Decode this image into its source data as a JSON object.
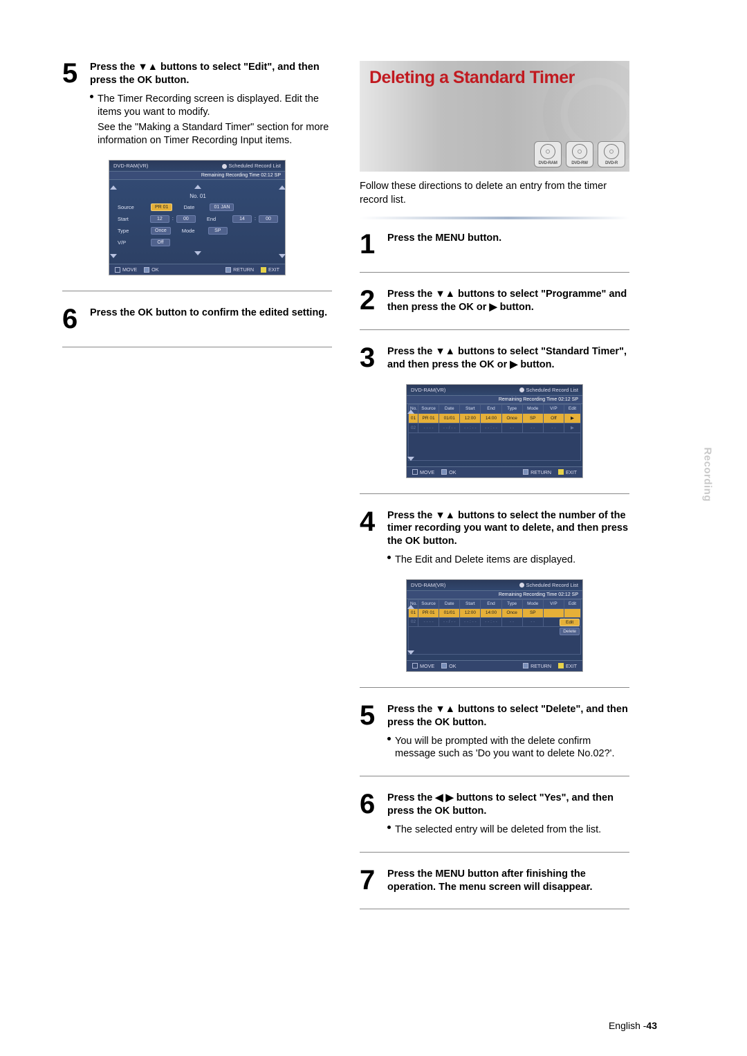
{
  "left": {
    "step5": {
      "title_pre": "Press the ",
      "title_mid": " buttons to select \"Edit\", and then press the OK button.",
      "bullet1": "The Timer Recording screen is displayed. Edit the items you want to modify.",
      "desc2": "See the \"Making a Standard Timer\" section for more information on Timer Recording Input items."
    },
    "step6": {
      "title": "Press the OK button to confirm the edited setting."
    },
    "osd1": {
      "disc": "DVD-RAM(VR)",
      "header": "Scheduled Record List",
      "remaining": "Remaining Recording Time 02:12 SP",
      "form_title": "No. 01",
      "rows": {
        "source": {
          "label": "Source",
          "val": "PR 01",
          "date_label": "Date",
          "date_val": "01 JAN"
        },
        "start": {
          "label": "Start",
          "h": "12",
          "m": "00",
          "end_label": "End",
          "eh": "14",
          "em": "00"
        },
        "type": {
          "label": "Type",
          "val": "Once",
          "mode_label": "Mode",
          "mode_val": "SP"
        },
        "vp": {
          "label": "V/P",
          "val": "Off"
        }
      },
      "foot": {
        "move": "MOVE",
        "ok": "OK",
        "ret": "RETURN",
        "exit": "EXIT"
      }
    }
  },
  "right": {
    "title": "Deleting a Standard Timer",
    "discs": [
      "DVD-RAM",
      "DVD-RW",
      "DVD-R"
    ],
    "intro": "Follow these directions to delete an entry from the timer record list.",
    "step1": {
      "title": "Press the MENU button."
    },
    "step2": {
      "title_pre": "Press the ",
      "title_mid": " buttons to select \"Programme\" and then press the OK or ",
      "title_post": " button."
    },
    "step3": {
      "title_pre": "Press the ",
      "title_mid": " buttons to select \"Standard Timer\", and then press the OK or ",
      "title_post": " button."
    },
    "step4": {
      "title_pre": "Press the ",
      "title_mid": " buttons to select the number of the timer recording you want to delete, and then press the OK button.",
      "bullet": "The Edit and Delete items are displayed."
    },
    "step5": {
      "title_pre": "Press the ",
      "title_mid": " buttons to select \"Delete\", and then press the OK button.",
      "bullet": "You will be prompted with the delete confirm message such as 'Do you want to delete No.02?'."
    },
    "step6": {
      "title_pre": "Press the ",
      "title_mid": " buttons to select \"Yes\", and then press the OK button.",
      "bullet": "The selected entry will be deleted from the list."
    },
    "step7": {
      "title": "Press the MENU button after finishing the operation. The menu screen will disappear."
    },
    "osd_table": {
      "disc": "DVD-RAM(VR)",
      "header": "Scheduled Record List",
      "remaining": "Remaining Recording Time 02:12 SP",
      "cols": [
        "No.",
        "Source",
        "Date",
        "Start",
        "End",
        "Type",
        "Mode",
        "V/P",
        "Edit"
      ],
      "rows": [
        {
          "no": "01",
          "source": "PR 01",
          "date": "01/01",
          "start": "12:00",
          "end": "14:00",
          "type": "Once",
          "mode": "SP",
          "vp": "Off",
          "edit": "▶",
          "sel": true
        },
        {
          "no": "02",
          "source": "- - - -",
          "date": "- - / - -",
          "start": "- - : - -",
          "end": "- - : - -",
          "type": "- -",
          "mode": "- -",
          "vp": "- -",
          "edit": "▶",
          "sel": false
        }
      ],
      "foot": {
        "move": "MOVE",
        "ok": "OK",
        "ret": "RETURN",
        "exit": "EXIT"
      }
    },
    "osd_table2": {
      "popup": {
        "edit": "Edit",
        "delete": "Delete"
      }
    }
  },
  "side_tab": "Recording",
  "footer": {
    "lang": "English -",
    "page": "43"
  },
  "icons": {
    "updown": "▼▲",
    "right": "▶",
    "leftright": "◀ ▶"
  }
}
